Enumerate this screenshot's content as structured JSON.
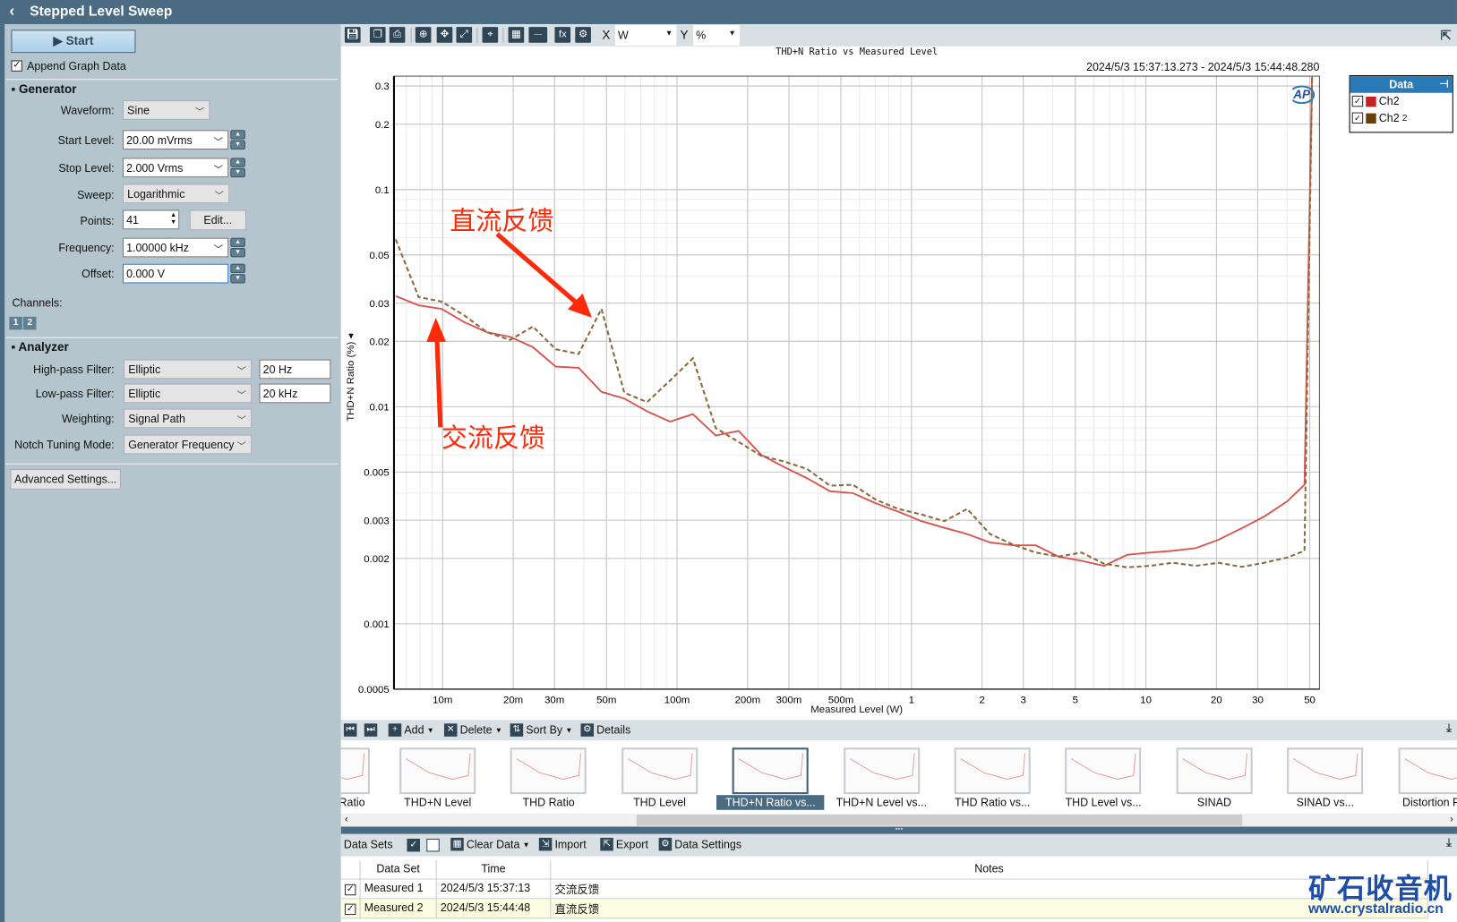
{
  "window": {
    "title": "Stepped Level Sweep"
  },
  "panel": {
    "start_label": "Start",
    "append_label": "Append Graph Data",
    "append_checked": true,
    "generator": {
      "title": "Generator",
      "waveform_label": "Waveform:",
      "waveform": "Sine",
      "start_level_label": "Start Level:",
      "start_level": "20.00 mVrms",
      "stop_level_label": "Stop Level:",
      "stop_level": "2.000 Vrms",
      "sweep_label": "Sweep:",
      "sweep": "Logarithmic",
      "points_label": "Points:",
      "points": "41",
      "edit_label": "Edit...",
      "frequency_label": "Frequency:",
      "frequency": "1.00000 kHz",
      "offset_label": "Offset:",
      "offset": "0.000 V",
      "channels_label": "Channels:",
      "channel_1": "1",
      "channel_2": "2"
    },
    "analyzer": {
      "title": "Analyzer",
      "hp_label": "High-pass Filter:",
      "hp": "Elliptic",
      "hp_freq": "20 Hz",
      "lp_label": "Low-pass Filter:",
      "lp": "Elliptic",
      "lp_freq": "20 kHz",
      "weighting_label": "Weighting:",
      "weighting": "Signal Path",
      "notch_label": "Notch Tuning Mode:",
      "notch": "Generator Frequency"
    },
    "advanced_label": "Advanced Settings..."
  },
  "toolbar": {
    "x_label": "X",
    "x_unit": "W",
    "y_label": "Y",
    "y_unit": "%"
  },
  "legend": {
    "title": "Data",
    "items": [
      {
        "label": "Ch2",
        "sub": "",
        "color": "#c42222"
      },
      {
        "label": "Ch2",
        "sub": "2",
        "color": "#6b3e0a"
      }
    ]
  },
  "annotations": {
    "dc": "直流反馈",
    "ac": "交流反馈",
    "color": "#ff2a0a"
  },
  "chart_data": {
    "type": "line",
    "title": "THD+N Ratio vs Measured Level",
    "time_range": "2024/5/3 15:37:13.273 - 2024/5/3 15:44:48.280",
    "xlabel": "Measured Level (W)",
    "ylabel": "THD+N Ratio (%)",
    "xscale": "log",
    "yscale": "log",
    "xlim": [
      0.0062,
      55
    ],
    "ylim": [
      0.0005,
      0.333
    ],
    "grid": true,
    "xticks": [
      {
        "v": 0.01,
        "l": "10m"
      },
      {
        "v": 0.02,
        "l": "20m"
      },
      {
        "v": 0.03,
        "l": "30m"
      },
      {
        "v": 0.05,
        "l": "50m"
      },
      {
        "v": 0.1,
        "l": "100m"
      },
      {
        "v": 0.2,
        "l": "200m"
      },
      {
        "v": 0.3,
        "l": "300m"
      },
      {
        "v": 0.5,
        "l": "500m"
      },
      {
        "v": 1,
        "l": "1"
      },
      {
        "v": 2,
        "l": "2"
      },
      {
        "v": 3,
        "l": "3"
      },
      {
        "v": 5,
        "l": "5"
      },
      {
        "v": 10,
        "l": "10"
      },
      {
        "v": 20,
        "l": "20"
      },
      {
        "v": 30,
        "l": "30"
      },
      {
        "v": 50,
        "l": "50"
      }
    ],
    "yticks": [
      {
        "v": 0.3,
        "l": "0.3"
      },
      {
        "v": 0.2,
        "l": "0.2"
      },
      {
        "v": 0.1,
        "l": "0.1"
      },
      {
        "v": 0.05,
        "l": "0.05"
      },
      {
        "v": 0.03,
        "l": "0.03"
      },
      {
        "v": 0.02,
        "l": "0.02"
      },
      {
        "v": 0.01,
        "l": "0.01"
      },
      {
        "v": 0.005,
        "l": "0.005"
      },
      {
        "v": 0.003,
        "l": "0.003"
      },
      {
        "v": 0.002,
        "l": "0.002"
      },
      {
        "v": 0.001,
        "l": "0.001"
      },
      {
        "v": 0.0005,
        "l": "0.0005"
      }
    ],
    "x": [
      0.00631,
      0.0079,
      0.00989,
      0.01238,
      0.01549,
      0.01939,
      0.02427,
      0.03038,
      0.03802,
      0.04759,
      0.05957,
      0.07456,
      0.09333,
      0.1168,
      0.1462,
      0.183,
      0.2291,
      0.2868,
      0.3589,
      0.4493,
      0.5623,
      0.7039,
      0.881,
      1.103,
      1.38,
      1.728,
      2.163,
      2.707,
      3.388,
      4.241,
      5.309,
      6.645,
      8.318,
      10.41,
      13.03,
      16.31,
      20.42,
      25.56,
      31.99,
      40.05,
      47.5,
      51.5
    ],
    "series": [
      {
        "name": "Ch2 (Measured 1)",
        "color": "#d9534f",
        "dash": false,
        "values": [
          0.0323,
          0.0293,
          0.0282,
          0.0245,
          0.022,
          0.021,
          0.0188,
          0.0153,
          0.0151,
          0.0117,
          0.0109,
          0.00952,
          0.00854,
          0.00924,
          0.00737,
          0.00774,
          0.00599,
          0.00527,
          0.00468,
          0.00408,
          0.004,
          0.00359,
          0.00328,
          0.00297,
          0.00277,
          0.00259,
          0.00237,
          0.0023,
          0.0023,
          0.00204,
          0.00195,
          0.00185,
          0.00208,
          0.00213,
          0.00217,
          0.00223,
          0.00244,
          0.00275,
          0.00312,
          0.00366,
          0.00437,
          0.5
        ]
      },
      {
        "name": "Ch2 2 (Measured 2)",
        "color": "#8b6a3e",
        "dash": true,
        "values": [
          0.059,
          0.032,
          0.0305,
          0.0263,
          0.022,
          0.0203,
          0.0234,
          0.0184,
          0.0175,
          0.0282,
          0.0116,
          0.0105,
          0.0132,
          0.0167,
          0.00797,
          0.00688,
          0.00593,
          0.00559,
          0.00516,
          0.00433,
          0.00437,
          0.00373,
          0.00338,
          0.00319,
          0.00297,
          0.00338,
          0.00259,
          0.00232,
          0.00213,
          0.00204,
          0.00213,
          0.00189,
          0.00182,
          0.00185,
          0.00191,
          0.00185,
          0.00191,
          0.00183,
          0.00191,
          0.00202,
          0.00217,
          0.5
        ]
      }
    ]
  },
  "graph_toolbar": {
    "add": "Add",
    "delete": "Delete",
    "sort": "Sort By",
    "details": "Details"
  },
  "thumbnails": [
    {
      "label": "THD+N Ratio"
    },
    {
      "label": "THD+N Level"
    },
    {
      "label": "THD Ratio"
    },
    {
      "label": "THD Level"
    },
    {
      "label": "THD+N Ratio vs...",
      "selected": true
    },
    {
      "label": "THD+N Level vs..."
    },
    {
      "label": "THD Ratio vs..."
    },
    {
      "label": "THD Level vs..."
    },
    {
      "label": "SINAD"
    },
    {
      "label": "SINAD vs..."
    },
    {
      "label": "Distortion Pro"
    }
  ],
  "datasets": {
    "title": "Data Sets",
    "clear": "Clear Data",
    "import": "Import",
    "export": "Export",
    "settings": "Data Settings",
    "columns": [
      "Data Set",
      "Time",
      "Notes"
    ],
    "rows": [
      {
        "name": "Measured 1",
        "time": "2024/5/3 15:37:13",
        "notes": "交流反馈",
        "checked": true
      },
      {
        "name": "Measured 2",
        "time": "2024/5/3 15:44:48",
        "notes": "直流反馈",
        "checked": true
      }
    ]
  },
  "watermark": {
    "cn": "矿石收音机",
    "url": "www.crystalradio.cn"
  }
}
